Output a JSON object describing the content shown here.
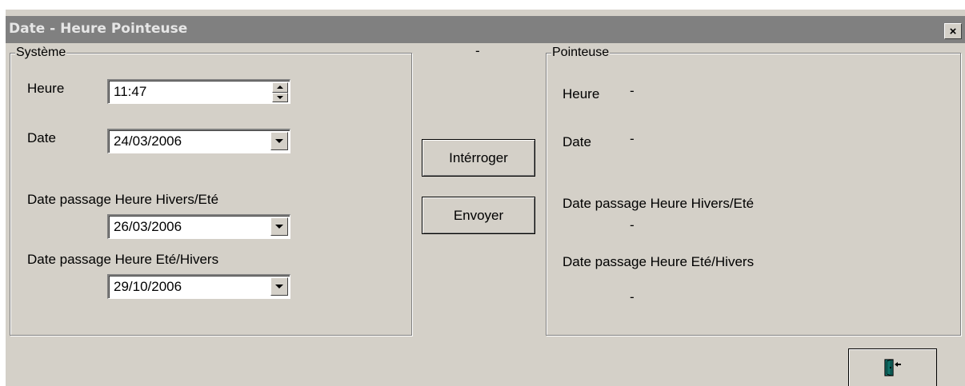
{
  "window": {
    "title": "Date - Heure Pointeuse",
    "close_glyph": "×"
  },
  "systeme": {
    "title": "Système",
    "heure_label": "Heure",
    "heure_value": "11:47",
    "date_label": "Date",
    "date_value": "24/03/2006",
    "hiver_ete_label": "Date passage Heure Hivers/Eté",
    "hiver_ete_value": "26/03/2006",
    "ete_hiver_label": "Date passage Heure Eté/Hivers",
    "ete_hiver_value": "29/10/2006"
  },
  "middle": {
    "status": "-",
    "interroger_label": "Intérroger",
    "envoyer_label": "Envoyer"
  },
  "pointeuse": {
    "title": "Pointeuse",
    "heure_label": "Heure",
    "heure_value": "-",
    "date_label": "Date",
    "date_value": "-",
    "hiver_ete_label": "Date passage Heure Hivers/Eté",
    "hiver_ete_value": "-",
    "ete_hiver_label": "Date passage Heure Eté/Hivers",
    "ete_hiver_value": "-"
  },
  "icons": {
    "close": "close-icon",
    "spin_up": "spin-up-icon",
    "spin_down": "spin-down-icon",
    "dropdown": "chevron-down-icon",
    "exit": "exit-door-icon"
  },
  "colors": {
    "window_bg": "#d4d0c8",
    "titlebar_bg": "#808080",
    "title_text": "#e6e6e6",
    "exit_icon": "#1aa39a"
  }
}
